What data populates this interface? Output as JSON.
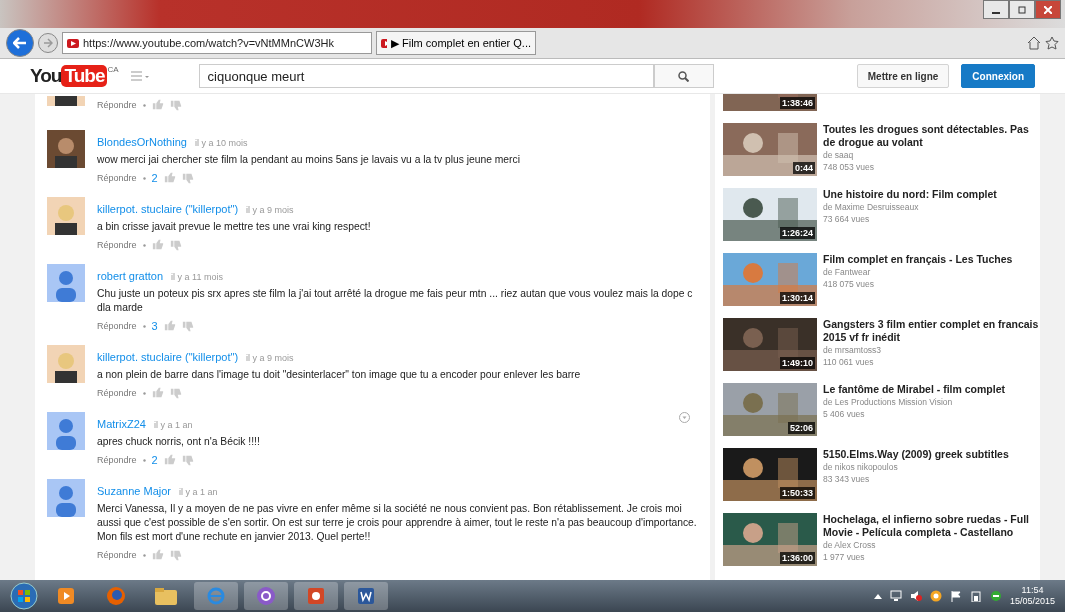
{
  "browser": {
    "url": "https://www.youtube.com/watch?v=vNtMMnCW3Hk",
    "tab_title": "▶ Film complet en entier Q..."
  },
  "header": {
    "logo_you": "You",
    "logo_tube": "Tube",
    "region": "CA",
    "search_value": "ciquonque meurt",
    "upload_button": "Mettre en ligne",
    "login_button": "Connexion"
  },
  "comments": [
    {
      "kind": "partial",
      "photo": true,
      "reply": "Répondre"
    },
    {
      "kind": "full",
      "photo": true,
      "author": "BlondesOrNothing",
      "time": "il y a 10 mois",
      "text": "wow merci jai chercher ste film la pendant au moins 5ans je lavais vu a la tv plus jeune merci",
      "reply": "Répondre",
      "likes": "2",
      "menu": false
    },
    {
      "kind": "full",
      "photo": true,
      "author": "killerpot. stuclaire (\"killerpot\")",
      "time": "il y a 9 mois",
      "text": "a bin crisse javait prevue le mettre tes une vrai king respect!",
      "reply": "Répondre",
      "menu": false
    },
    {
      "kind": "full",
      "photo": false,
      "author": "robert gratton",
      "time": "il y a 11 mois",
      "text": "Chu juste un poteux pis srx apres ste film la j'ai tout arrêté la drogue me fais peur mtn ... riez autan que vous voulez mais la dope c dla marde",
      "reply": "Répondre",
      "likes": "3",
      "menu": false
    },
    {
      "kind": "full",
      "photo": true,
      "author": "killerpot. stuclaire (\"killerpot\")",
      "time": "il y a 9 mois",
      "text": "a non plein de barre dans l'image tu doit \"desinterlacer\" ton image que tu a encoder pour enlever les barre",
      "reply": "Répondre",
      "menu": false
    },
    {
      "kind": "full",
      "photo": false,
      "author": "MatrixZ24",
      "time": "il y a 1 an",
      "text": "apres chuck norris, ont n'a Bécik !!!!",
      "reply": "Répondre",
      "likes": "2",
      "menu": true
    },
    {
      "kind": "full",
      "photo": false,
      "author": "Suzanne Major",
      "time": "il y a 1 an",
      "text": "Merci Vanessa, Il y a moyen de ne pas vivre en enfer même si la société ne nous convient pas. Bon rétablissement.  Je crois moi aussi que c'est possible de s'en sortir.  On est sur terre je crois pour apprendre à aimer, tout le reste n'a pas beaucoup d'importance. Mon fils est mort d'une rechute en janvier 2013. Quel perte!!",
      "reply": "Répondre",
      "menu": false
    }
  ],
  "related": [
    {
      "kind": "partial",
      "duration": "1:38:46"
    },
    {
      "kind": "full",
      "title": "Toutes les drogues sont détectables. Pas de drogue au volant",
      "channel": "de saaq",
      "views": "748 053 vues",
      "duration": "0:44"
    },
    {
      "kind": "full",
      "title": "Une histoire du nord: Film complet",
      "channel": "de Maxime Desruisseaux",
      "views": "73 664 vues",
      "duration": "1:26:24"
    },
    {
      "kind": "full",
      "title": "Film complet en français - Les Tuches",
      "channel": "de Fantwear",
      "views": "418 075 vues",
      "duration": "1:30:14"
    },
    {
      "kind": "full",
      "title": "Gangsters 3 film entier complet en francais 2015 vf fr inédit",
      "channel": "de mrsamtoss3",
      "views": "110 061 vues",
      "duration": "1:49:10"
    },
    {
      "kind": "full",
      "title": "Le fantôme de Mirabel - film complet",
      "channel": "de Les Productions Mission Vision",
      "views": "5 406 vues",
      "duration": "52:06"
    },
    {
      "kind": "full",
      "title": "5150.Elms.Way (2009) greek subtitles",
      "channel": "de nikos nikopoulos",
      "views": "83 343 vues",
      "duration": "1:50:33"
    },
    {
      "kind": "full",
      "title": "Hochelaga, el infierno sobre ruedas - Full Movie - Película completa - Castellano",
      "channel": "de Alex Cross",
      "views": "1 977 vues",
      "duration": "1:36:00"
    }
  ],
  "taskbar": {
    "time": "11:54",
    "date": "15/05/2015"
  }
}
